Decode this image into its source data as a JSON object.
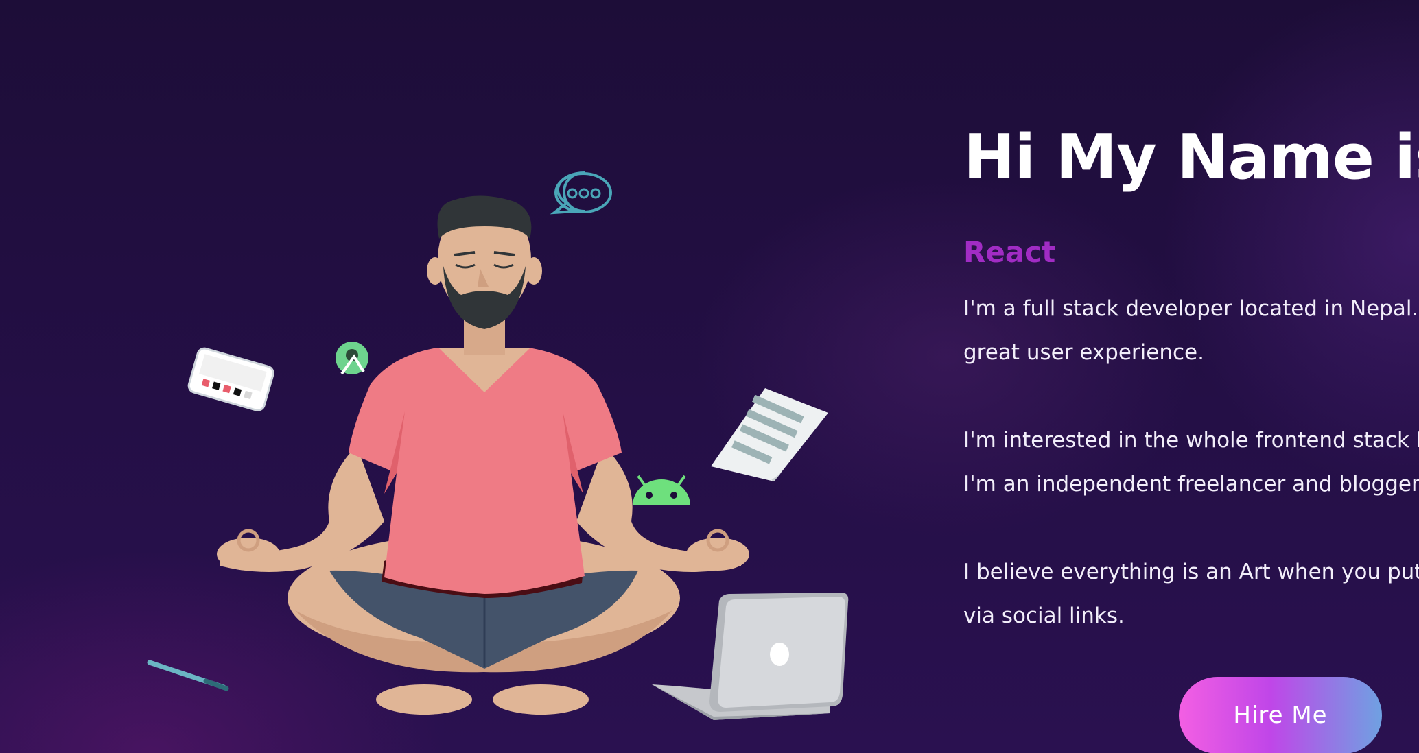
{
  "hero": {
    "greeting": "Hi My Name is Ay",
    "role": "React",
    "bio_lines": [
      "I'm a full stack developer located in Nepal. I lo",
      "great user experience.",
      "I'm interested in the whole frontend stack Like",
      "I'm an independent freelancer and blogger. I l",
      "I believe everything is an Art when you put yo",
      "via social links."
    ],
    "cta_label": "Hire Me"
  },
  "theme": {
    "background": "#1d0d38",
    "accent": "#a12cc4",
    "button_gradient": [
      "#f35fe3",
      "#c046e8",
      "#6fa1e2"
    ]
  },
  "illustration": {
    "description_icons": [
      "meditating-man",
      "chat-bubble-icon",
      "android-studio-icon",
      "android-icon",
      "phone-mockup",
      "document-icon",
      "laptop-icon",
      "pen-icon"
    ]
  }
}
